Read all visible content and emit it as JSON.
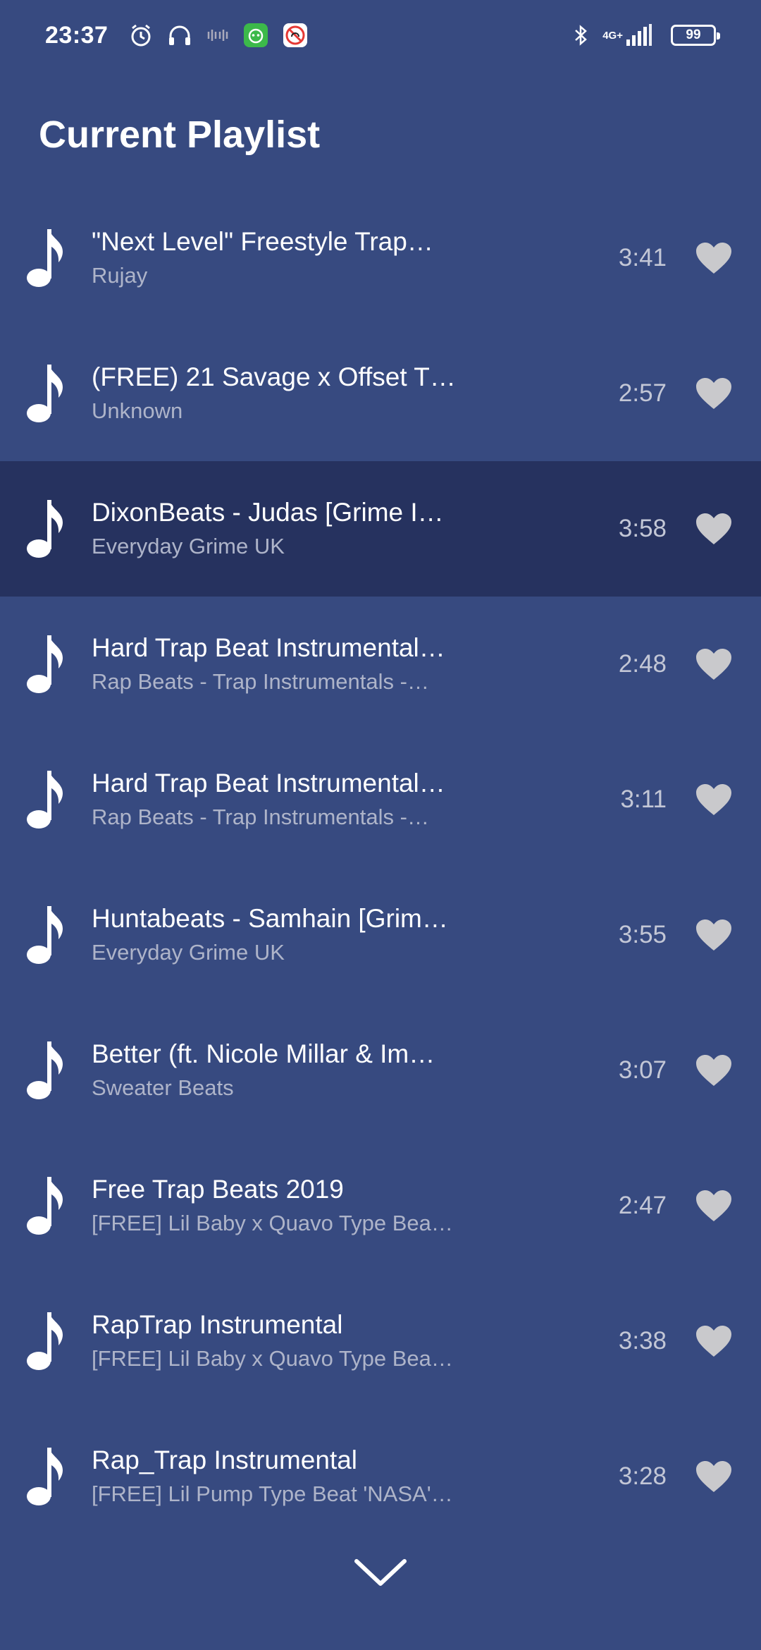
{
  "status_bar": {
    "time": "23:37",
    "battery": "99",
    "network": "4G+",
    "icons": [
      "alarm-icon",
      "headphones-icon",
      "vibrate-icon",
      "app-notification-icon",
      "no-disturb-icon",
      "bluetooth-icon",
      "signal-icon",
      "battery-icon"
    ]
  },
  "header": {
    "title": "Current Playlist"
  },
  "playlist": {
    "active_index": 2,
    "tracks": [
      {
        "title": "\"Next Level\"   Freestyle Trap…",
        "artist": "Rujay",
        "duration": "3:41"
      },
      {
        "title": "(FREE) 21 Savage x Offset T…",
        "artist": "Unknown",
        "duration": "2:57"
      },
      {
        "title": "DixonBeats - Judas [Grime I…",
        "artist": "Everyday Grime UK",
        "duration": "3:58"
      },
      {
        "title": "Hard Trap Beat Instrumental…",
        "artist": "Rap Beats - Trap Instrumentals -…",
        "duration": "2:48"
      },
      {
        "title": "Hard Trap Beat Instrumental…",
        "artist": "Rap Beats - Trap Instrumentals -…",
        "duration": "3:11"
      },
      {
        "title": "Huntabeats - Samhain [Grim…",
        "artist": "Everyday Grime UK",
        "duration": "3:55"
      },
      {
        "title": "Better (ft. Nicole Millar & Im…",
        "artist": "Sweater Beats",
        "duration": "3:07"
      },
      {
        "title": "Free Trap Beats 2019",
        "artist": "[FREE] Lil Baby x Quavo Type Bea…",
        "duration": "2:47"
      },
      {
        "title": "RapTrap Instrumental",
        "artist": "[FREE] Lil Baby x Quavo Type Bea…",
        "duration": "3:38"
      },
      {
        "title": "Rap_Trap Instrumental",
        "artist": "[FREE] Lil Pump Type Beat 'NASA'…",
        "duration": "3:28"
      }
    ]
  },
  "footer": {
    "collapse_icon": "chevron-down-icon"
  },
  "colors": {
    "background": "#374a80",
    "active_row": "#26325f",
    "subtitle": "#aeb4c9",
    "heart": "#c9c9cc"
  }
}
